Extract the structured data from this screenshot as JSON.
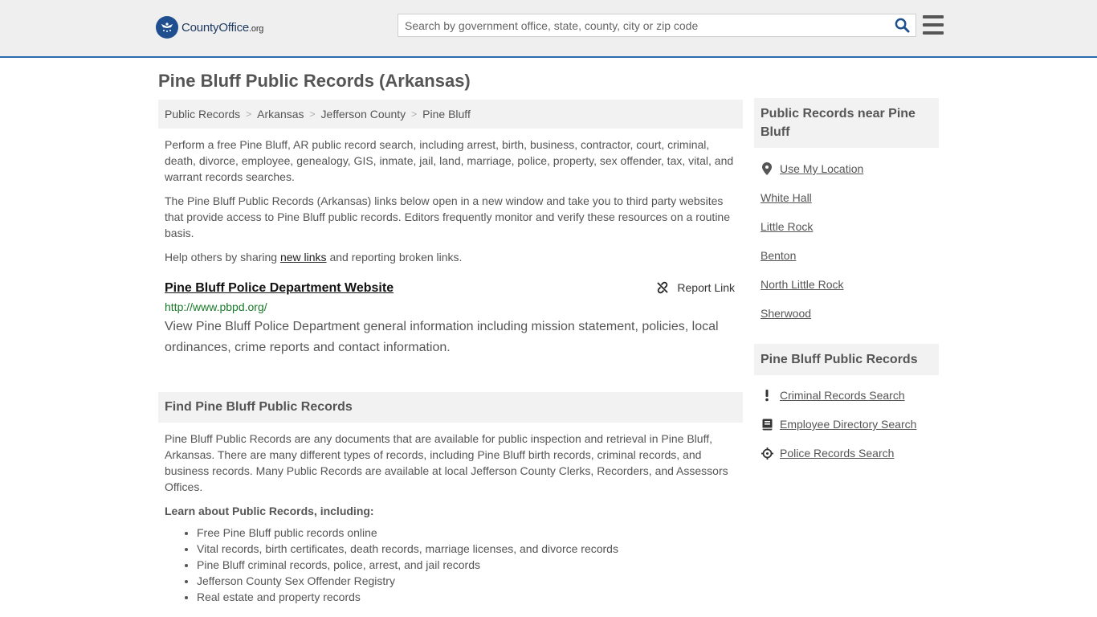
{
  "header": {
    "logo_text_main": "CountyOffice",
    "logo_text_tld": ".org",
    "search_placeholder": "Search by government office, state, county, city or zip code"
  },
  "page_title": "Pine Bluff Public Records (Arkansas)",
  "breadcrumb": [
    "Public Records",
    "Arkansas",
    "Jefferson County",
    "Pine Bluff"
  ],
  "intro": {
    "p1": "Perform a free Pine Bluff, AR public record search, including arrest, birth, business, contractor, court, criminal, death, divorce, employee, genealogy, GIS, inmate, jail, land, marriage, police, property, sex offender, tax, vital, and warrant records searches.",
    "p2": "The Pine Bluff Public Records (Arkansas) links below open in a new window and take you to third party websites that provide access to Pine Bluff public records. Editors frequently monitor and verify these resources on a routine basis.",
    "p3_before": "Help others by sharing ",
    "p3_link": "new links",
    "p3_after": " and reporting broken links."
  },
  "link_card": {
    "title": "Pine Bluff Police Department Website",
    "report_label": "Report Link",
    "url": "http://www.pbpd.org/",
    "description": "View Pine Bluff Police Department general information including mission statement, policies, local ordinances, crime reports and contact information."
  },
  "find_section": {
    "heading": "Find Pine Bluff Public Records",
    "body": "Pine Bluff Public Records are any documents that are available for public inspection and retrieval in Pine Bluff, Arkansas. There are many different types of records, including Pine Bluff birth records, criminal records, and business records. Many Public Records are available at local Jefferson County Clerks, Recorders, and Assessors Offices.",
    "learn_heading": "Learn about Public Records, including:",
    "bullets": [
      "Free Pine Bluff public records online",
      "Vital records, birth certificates, death records, marriage licenses, and divorce records",
      "Pine Bluff criminal records, police, arrest, and jail records",
      "Jefferson County Sex Offender Registry",
      "Real estate and property records"
    ]
  },
  "sidebar": {
    "near_heading": "Public Records near Pine Bluff",
    "use_location": "Use My Location",
    "near_items": [
      "White Hall",
      "Little Rock",
      "Benton",
      "North Little Rock",
      "Sherwood"
    ],
    "records_heading": "Pine Bluff Public Records",
    "records_items": [
      {
        "label": "Criminal Records Search",
        "icon": "exclamation-icon"
      },
      {
        "label": "Employee Directory Search",
        "icon": "book-icon"
      },
      {
        "label": "Police Records Search",
        "icon": "crosshair-icon"
      }
    ]
  }
}
